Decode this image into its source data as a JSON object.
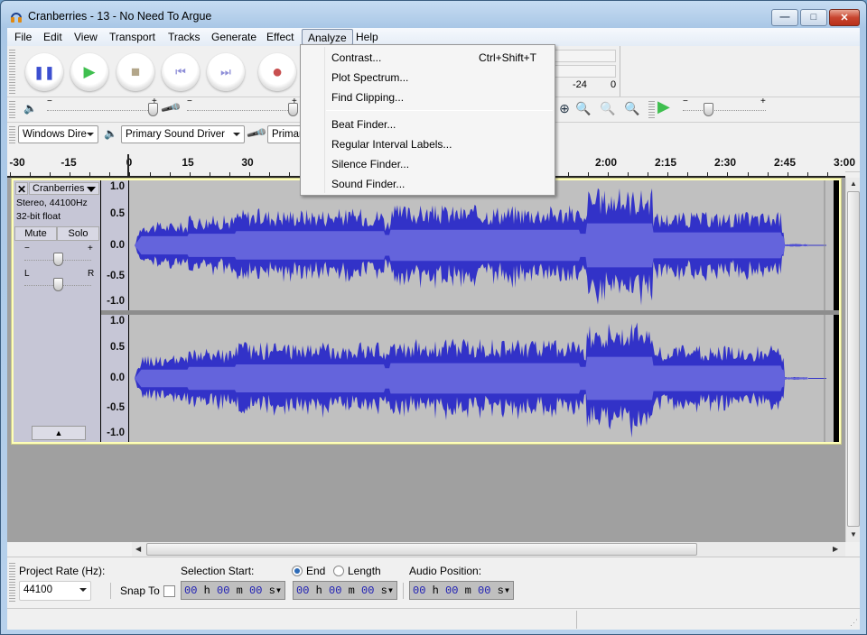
{
  "window": {
    "title": "Cranberries - 13 - No Need To Argue",
    "controls": {
      "minimize": "—",
      "maximize": "□",
      "close": "✕"
    }
  },
  "menubar": {
    "items": [
      {
        "label": "File"
      },
      {
        "label": "Edit"
      },
      {
        "label": "View"
      },
      {
        "label": "Transport"
      },
      {
        "label": "Tracks"
      },
      {
        "label": "Generate"
      },
      {
        "label": "Effect"
      },
      {
        "label": "Analyze",
        "active": true
      },
      {
        "label": "Help"
      }
    ]
  },
  "analyze_menu": {
    "items": [
      {
        "label": "Contrast...",
        "shortcut": "Ctrl+Shift+T"
      },
      {
        "label": "Plot Spectrum..."
      },
      {
        "label": "Find Clipping..."
      },
      {
        "label": "Beat Finder..."
      },
      {
        "label": "Regular Interval Labels..."
      },
      {
        "label": "Silence Finder..."
      },
      {
        "label": "Sound Finder..."
      }
    ]
  },
  "transport": {
    "buttons": [
      {
        "name": "pause",
        "glyph": "❚❚",
        "color": "#3c4fd0"
      },
      {
        "name": "play",
        "glyph": "▶",
        "color": "#3fbf4f"
      },
      {
        "name": "stop",
        "glyph": "■",
        "color": "#b3a68a"
      },
      {
        "name": "skip-start",
        "glyph": "⏮",
        "color": "#8f8fd8"
      },
      {
        "name": "skip-end",
        "glyph": "⏭",
        "color": "#8f8fd8"
      },
      {
        "name": "record",
        "glyph": "●",
        "color": "#c85050"
      }
    ]
  },
  "mixer": {
    "output_volume": 1.0,
    "input_volume": 1.0,
    "minus": "−",
    "plus": "+"
  },
  "meter": {
    "labels": [
      "-24",
      "0"
    ]
  },
  "devices": {
    "host": "Windows Dire",
    "output": "Primary Sound Driver",
    "input": "Primar"
  },
  "playback_speed": {
    "value": 0.4,
    "minus": "−",
    "plus": "+"
  },
  "ruler": {
    "labels": [
      "-30",
      "-15",
      "0",
      "15",
      "30",
      "2:00",
      "2:15",
      "2:30",
      "2:45",
      "3:00"
    ]
  },
  "track": {
    "name": "Cranberries",
    "format": "Stereo, 44100Hz",
    "bitdepth": "32-bit float",
    "mute": "Mute",
    "solo": "Solo",
    "gain_minus": "−",
    "gain_plus": "+",
    "pan_left": "L",
    "pan_right": "R",
    "gain": 0.5,
    "pan": 0.5,
    "scale": [
      "1.0",
      "0.5",
      "0.0",
      "-0.5",
      "-1.0"
    ],
    "waveform_color": "#3232c8",
    "rms_color": "#6464dc",
    "background_color": "#c0c0c0"
  },
  "selection_bar": {
    "project_rate_label": "Project Rate (Hz):",
    "project_rate": "44100",
    "snap_to": "Snap To",
    "snap_checked": false,
    "selection_start_label": "Selection Start:",
    "end_label": "End",
    "length_label": "Length",
    "end_selected": true,
    "audio_position_label": "Audio Position:",
    "selection_start": "00 h 00 m 00 s",
    "selection_end": "00 h 00 m 00 s",
    "audio_position": "00 h 00 m 00 s"
  }
}
